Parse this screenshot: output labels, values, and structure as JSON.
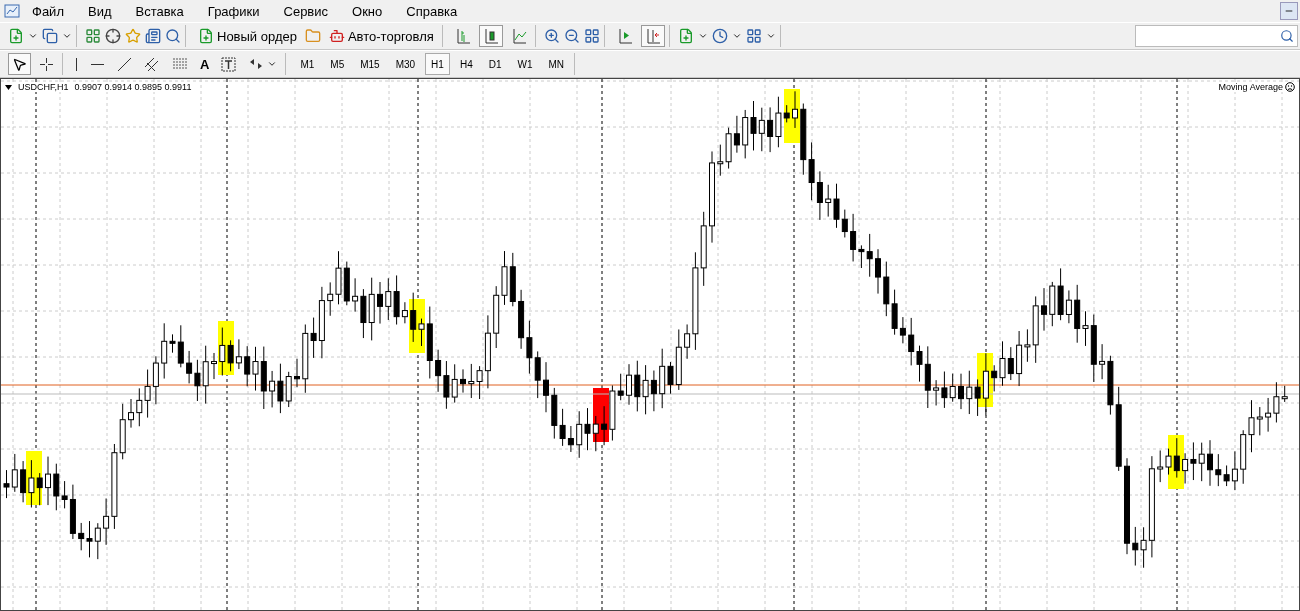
{
  "menu": [
    "Файл",
    "Вид",
    "Вставка",
    "Графики",
    "Сервис",
    "Окно",
    "Справка"
  ],
  "toolbar": {
    "new_order": "Новый ордер",
    "auto_trading": "Авто-торговля",
    "chart_types": [
      {
        "selected": false
      },
      {
        "selected": true
      },
      {
        "selected": false
      }
    ],
    "chart_shift": {
      "selected": false
    },
    "autoscroll": {
      "selected": true
    }
  },
  "tools": [
    {
      "kind": "cursor",
      "selected": true
    },
    {
      "kind": "crosshair",
      "selected": false
    },
    {
      "kind": "vline",
      "selected": false
    },
    {
      "kind": "hline",
      "selected": false
    },
    {
      "kind": "trendline",
      "selected": false
    },
    {
      "kind": "channel",
      "selected": false
    },
    {
      "kind": "fibo",
      "selected": false
    },
    {
      "kind": "text",
      "label": "A",
      "selected": false
    },
    {
      "kind": "label",
      "selected": false
    },
    {
      "kind": "arrows",
      "selected": false
    }
  ],
  "timeframes": [
    {
      "label": "M1",
      "selected": false
    },
    {
      "label": "M5",
      "selected": false
    },
    {
      "label": "M15",
      "selected": false
    },
    {
      "label": "M30",
      "selected": false
    },
    {
      "label": "H1",
      "selected": true
    },
    {
      "label": "H4",
      "selected": false
    },
    {
      "label": "D1",
      "selected": false
    },
    {
      "label": "W1",
      "selected": false
    },
    {
      "label": "MN",
      "selected": false
    }
  ],
  "chart": {
    "symbol": "USDCHF,H1",
    "prices": "0.9907 0.9914 0.9895 0.9911",
    "indicator": "Moving Average"
  }
}
